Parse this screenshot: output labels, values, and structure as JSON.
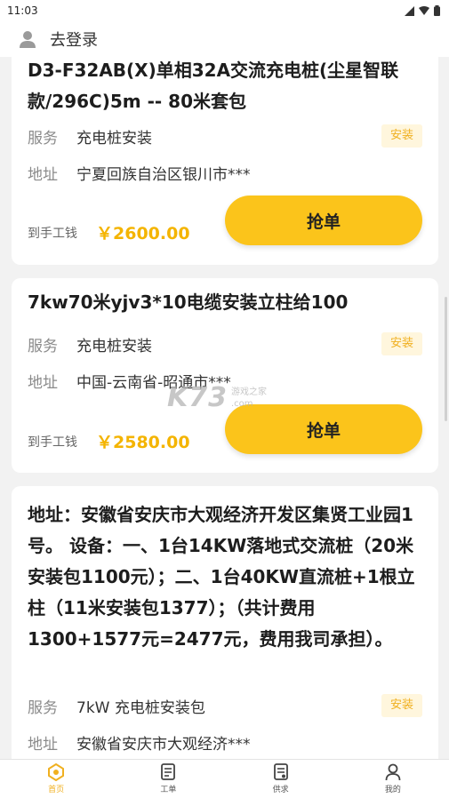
{
  "status_bar": {
    "time": "11:03"
  },
  "header": {
    "login_label": "去登录"
  },
  "orders": [
    {
      "title": "D3-F32AB(X)单相32A交流充电桩(尘星智联款/296C)5m -- 80米套包",
      "service_label": "服务",
      "service": "充电桩安装",
      "tag": "安装",
      "address_label": "地址",
      "address": "宁夏回族自治区银川市***",
      "wage_label": "到手工钱",
      "wage": "￥2600.00",
      "button": "抢单"
    },
    {
      "title": "7kw70米yjv3*10电缆安装立柱给100",
      "service_label": "服务",
      "service": "充电桩安装",
      "tag": "安装",
      "address_label": "地址",
      "address": "中国-云南省-昭通市***",
      "wage_label": "到手工钱",
      "wage": "￥2580.00",
      "button": "抢单"
    },
    {
      "title": "地址：安徽省安庆市大观经济开发区集贤工业园1号。 设备：一、1台14KW落地式交流桩（20米安装包1100元）；二、1台40KW直流桩+1根立柱（11米安装包1377）；（共计费用1300+1577元=2477元，费用我司承担）。",
      "service_label": "服务",
      "service": "7kW 充电桩安装包",
      "tag": "安装",
      "address_label": "地址",
      "address": "安徽省安庆市大观经济***"
    }
  ],
  "watermark": {
    "main": "K73",
    "sub_cn": "游戏之家",
    "sub_url": ".com"
  },
  "tabbar": {
    "tabs": [
      {
        "label": "首页",
        "icon": "home-icon",
        "active": true
      },
      {
        "label": "工单",
        "icon": "work-order-icon",
        "active": false
      },
      {
        "label": "供求",
        "icon": "supply-demand-icon",
        "active": false
      },
      {
        "label": "我的",
        "icon": "profile-icon",
        "active": false
      }
    ]
  },
  "colors": {
    "accent": "#fbc41b",
    "price": "#f4b400",
    "tag_bg": "#fff6dd",
    "tag_text": "#f0b020"
  }
}
